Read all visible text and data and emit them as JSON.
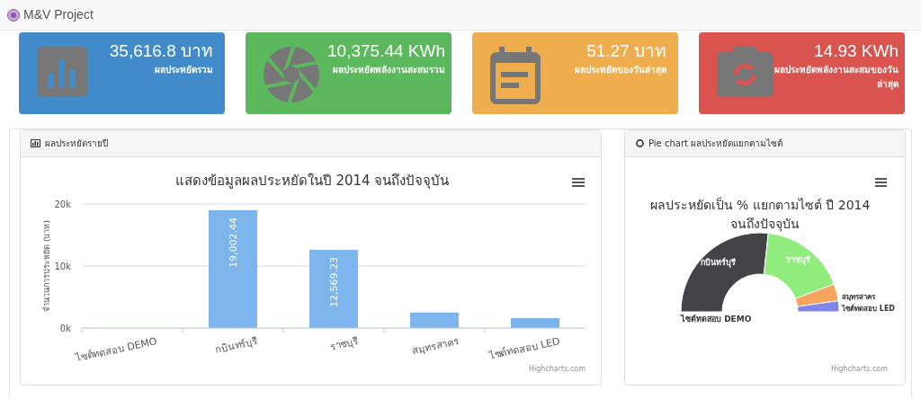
{
  "header": {
    "title": "M&V Project"
  },
  "cards": [
    {
      "kind": "chart",
      "color": "#428bca",
      "value": "35,616.8 บาท",
      "label": "ผลประหยัดรวม"
    },
    {
      "kind": "aperture",
      "color": "#5cb85c",
      "value": "10,375.44 KWh",
      "label": "ผลประหยัดพลังงานสะสมรวม"
    },
    {
      "kind": "calendar",
      "color": "#f0ad4e",
      "value": "51.27 บาท",
      "label": "ผลประหยัดของวันล่าสุด"
    },
    {
      "kind": "camera",
      "color": "#d9534f",
      "value": "14.93 KWh",
      "label": "ผลประหยัดพลังงานสะสมของวันล่าสุด"
    }
  ],
  "bar_panel": {
    "heading": "ผลประหยัดรายปี",
    "credit": "Highcharts.com",
    "chart_data": {
      "type": "bar",
      "title": "แสดงข้อมูลผลประหยัดในปี 2014 จนถึงปัจจุบัน",
      "ylabel": "จำนวนการประหยัด (บาท)",
      "categories": [
        "ไซต์ทดสอบ DEMO",
        "กบินทร์บุรี",
        "ราชบุรี",
        "สมุทรสาคร",
        "ไซต์ทดสอบ LED"
      ],
      "series": [
        {
          "color": "#7cb5ec",
          "values": [
            0,
            19000,
            12600,
            2500,
            1600
          ]
        }
      ],
      "ylim": [
        0,
        20000
      ],
      "yticks": [
        {
          "value": 0,
          "label": "0k"
        },
        {
          "value": 10000,
          "label": "10k"
        },
        {
          "value": 20000,
          "label": "20k"
        }
      ],
      "value_labels": [
        null,
        "19,002.44",
        "12,569.23",
        null,
        null
      ]
    }
  },
  "pie_panel": {
    "heading": "Pie chart ผลประหยัดแยกตามไซต์",
    "credit": "Highcharts.com",
    "chart_data": {
      "type": "donut",
      "title": "ผลประหยัดเป็น % แยกตามไซต์ ปี 2014 จนถึงปัจจุบัน",
      "categories": [
        "ไซต์ทดสอบ DEMO",
        "กบินทร์บุรี",
        "ราชบุรี",
        "สมุทรสาคร",
        "ไซต์ทดสอบ LED"
      ],
      "series": [
        {
          "values": [
            0,
            53.35,
            35.29,
            6.88,
            4.48
          ]
        }
      ],
      "colors": [
        "#434348",
        "#434348",
        "#90ed7d",
        "#f7a35c",
        "#8085e9"
      ]
    }
  }
}
